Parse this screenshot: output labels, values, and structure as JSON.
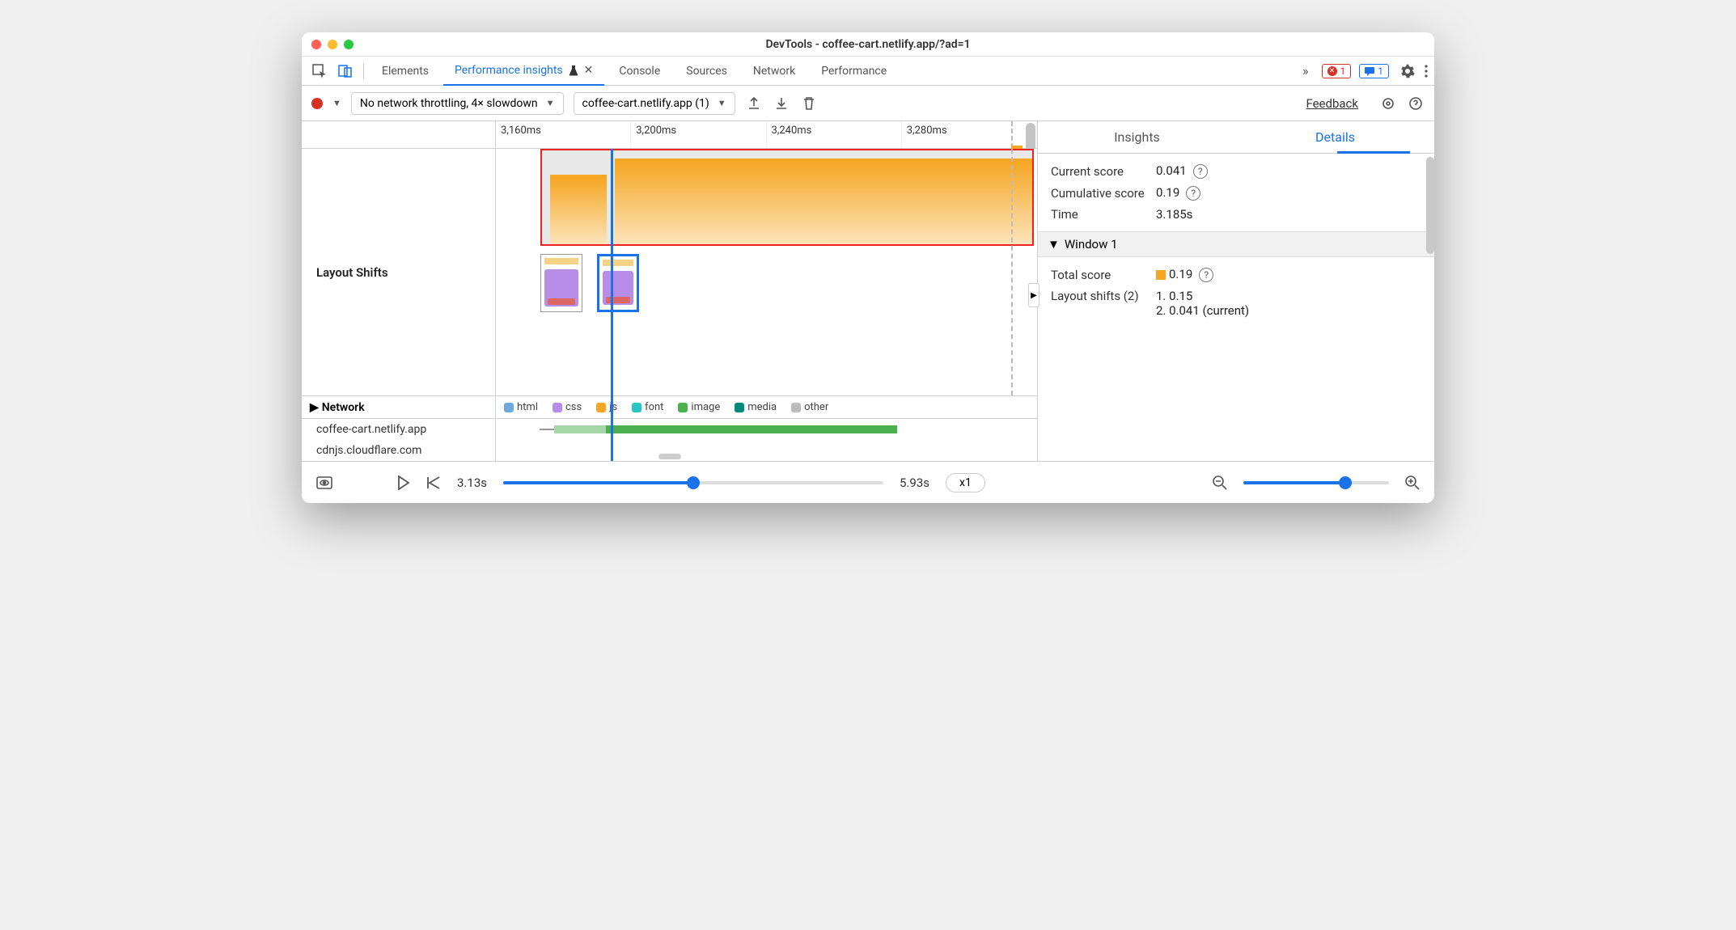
{
  "window": {
    "title": "DevTools - coffee-cart.netlify.app/?ad=1"
  },
  "tabs": {
    "elements": "Elements",
    "perf_insights": "Performance insights",
    "console": "Console",
    "sources": "Sources",
    "network": "Network",
    "performance": "Performance"
  },
  "badges": {
    "errors": "1",
    "messages": "1"
  },
  "toolbar": {
    "throttling": "No network throttling, 4× slowdown",
    "recording": "coffee-cart.netlify.app (1)",
    "feedback": "Feedback"
  },
  "timeline": {
    "t1": "3,160ms",
    "t2": "3,200ms",
    "t3": "3,240ms",
    "t4": "3,280ms"
  },
  "rows": {
    "layout_shifts": "Layout Shifts",
    "network": "Network"
  },
  "legend": {
    "html": "html",
    "css": "css",
    "js": "js",
    "font": "font",
    "image": "image",
    "media": "media",
    "other": "other"
  },
  "hosts": {
    "h1": "coffee-cart.netlify.app",
    "h2": "cdnjs.cloudflare.com"
  },
  "right": {
    "tab_insights": "Insights",
    "tab_details": "Details",
    "current_score_label": "Current score",
    "current_score": "0.041",
    "cumulative_label": "Cumulative score",
    "cumulative": "0.19",
    "time_label": "Time",
    "time": "3.185s",
    "window1": "Window 1",
    "total_score_label": "Total score",
    "total_score": "0.19",
    "layout_shifts_label": "Layout shifts (2)",
    "ls1": "1. 0.15",
    "ls2": "2. 0.041 (current)"
  },
  "footer": {
    "start": "3.13s",
    "end": "5.93s",
    "speed": "x1"
  }
}
